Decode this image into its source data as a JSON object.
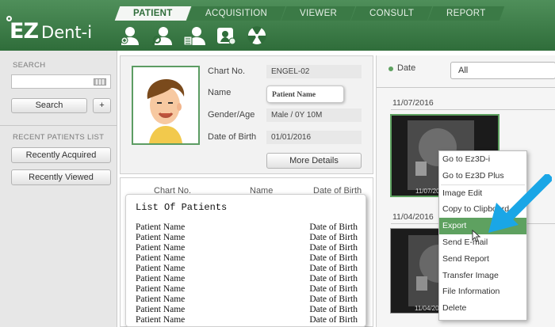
{
  "app": {
    "logo_ez": "EZ",
    "logo_rest": "Dent-i"
  },
  "tabs": [
    {
      "label": "PATIENT",
      "active": true
    },
    {
      "label": "ACQUISITION",
      "active": false
    },
    {
      "label": "VIEWER",
      "active": false
    },
    {
      "label": "CONSULT",
      "active": false
    },
    {
      "label": "REPORT",
      "active": false
    }
  ],
  "toolbar": {
    "icons": [
      "add-patient-icon",
      "search-patient-icon",
      "patient-list-icon",
      "patient-settings-icon",
      "radiation-icon"
    ]
  },
  "sidebar": {
    "search_title": "SEARCH",
    "search_value": "",
    "search_button": "Search",
    "plus_button": "+",
    "recent_title": "RECENT PATIENTS LIST",
    "recently_acquired": "Recently Acquired",
    "recently_viewed": "Recently Viewed"
  },
  "patient": {
    "chart_label": "Chart No.",
    "chart_value": "ENGEL-02",
    "name_label": "Name",
    "name_value": "Patient Name",
    "gender_label": "Gender/Age",
    "gender_value": "Male / 0Y 10M",
    "dob_label": "Date of Birth",
    "dob_value": "01/01/2016",
    "more_details": "More Details"
  },
  "patient_table": {
    "headers": [
      "Chart No.",
      "Name",
      "Date of Birth"
    ]
  },
  "patient_popup": {
    "title": "List Of Patients",
    "rows": [
      {
        "name": "Patient Name",
        "dob": "Date of Birth"
      },
      {
        "name": "Patient Name",
        "dob": "Date of Birth"
      },
      {
        "name": "Patient Name",
        "dob": "Date of Birth"
      },
      {
        "name": "Patient Name",
        "dob": "Date of Birth"
      },
      {
        "name": "Patient Name",
        "dob": "Date of Birth"
      },
      {
        "name": "Patient Name",
        "dob": "Date of Birth"
      },
      {
        "name": "Patient Name",
        "dob": "Date of Birth"
      },
      {
        "name": "Patient Name",
        "dob": "Date of Birth"
      },
      {
        "name": "Patient Name",
        "dob": "Date of Birth"
      },
      {
        "name": "Patient Name",
        "dob": "Date of Birth"
      }
    ]
  },
  "images": {
    "filter_label": "Date",
    "filter_value": "All",
    "groups": [
      {
        "date": "11/07/2016",
        "thumb_caption": "11/07/20"
      },
      {
        "date": "11/04/2016",
        "thumb_caption": "11/04/20"
      }
    ]
  },
  "context_menu": {
    "items": [
      "Go to Ez3D-i",
      "Go to Ez3D Plus",
      "Image Edit",
      "Copy to Clipboard",
      "Export",
      "Send E-mail",
      "Send Report",
      "Transfer Image",
      "File Information",
      "Delete"
    ],
    "highlighted": "Export"
  },
  "colors": {
    "brand_green": "#2f6d3a",
    "highlight_green": "#5ea160",
    "arrow_blue": "#1aa6e6"
  }
}
